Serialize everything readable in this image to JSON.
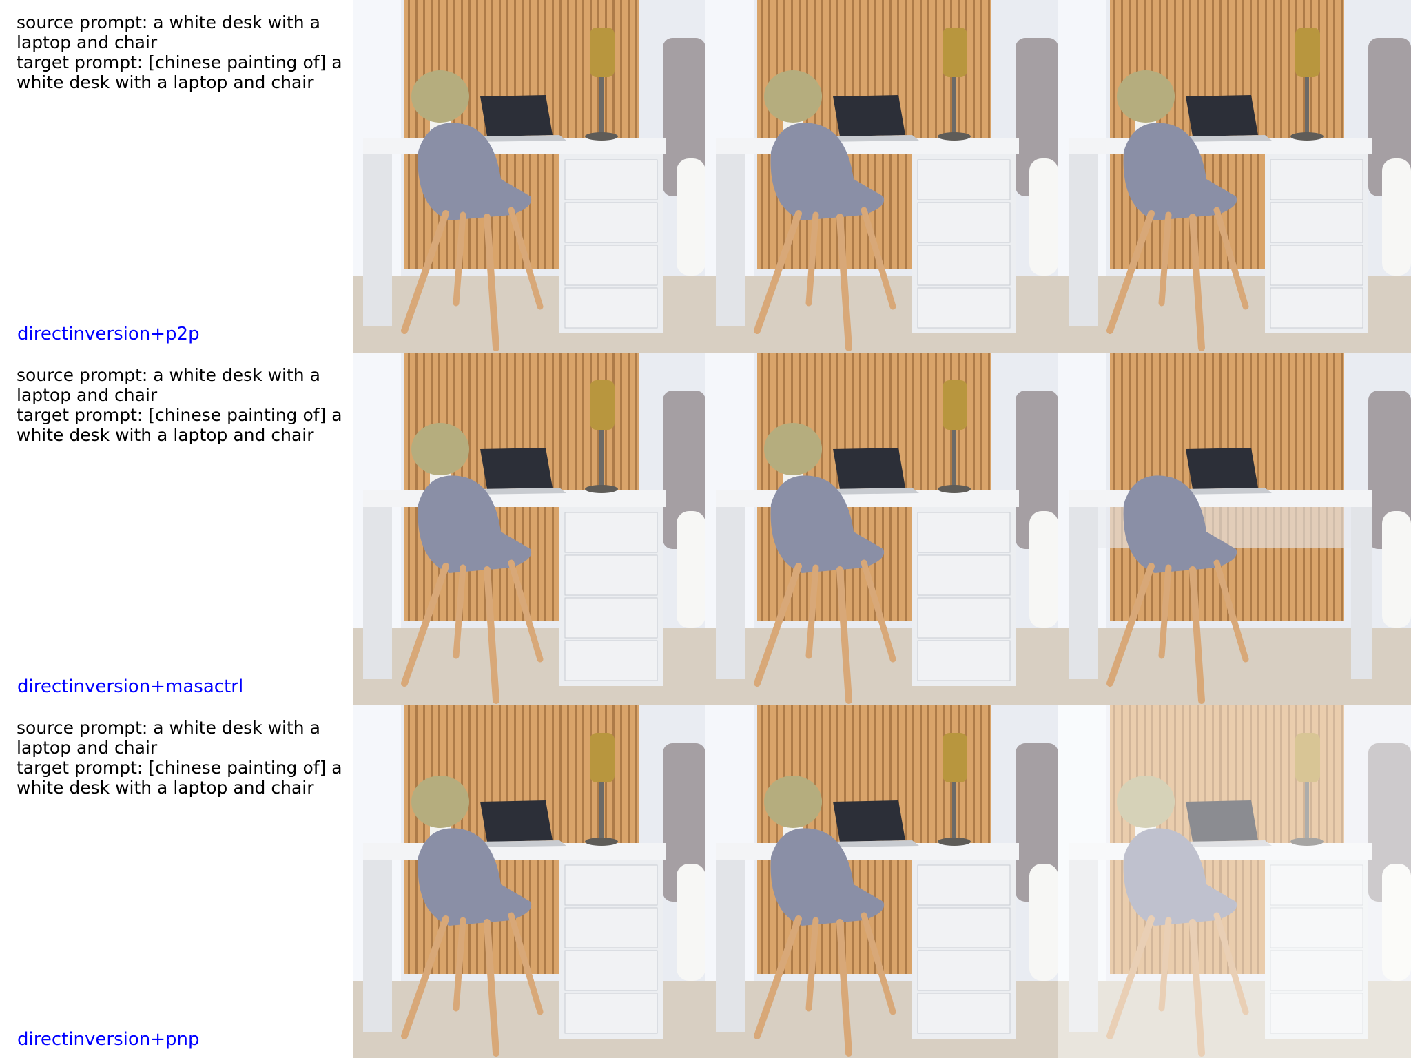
{
  "rows": [
    {
      "source_prompt": "source prompt: a white desk with a laptop and chair",
      "target_prompt": "target prompt: [chinese painting of] a white desk with a laptop and chair",
      "method": "directinversion+p2p",
      "images": [
        {
          "kind": "original",
          "lamp": true,
          "drawers": true,
          "plant": true,
          "painted": false
        },
        {
          "kind": "reconstruction",
          "lamp": true,
          "drawers": true,
          "plant": true,
          "painted": false
        },
        {
          "kind": "edited",
          "lamp": true,
          "drawers": true,
          "plant": true,
          "painted": false
        }
      ]
    },
    {
      "source_prompt": "source prompt: a white desk with a laptop and chair",
      "target_prompt": "target prompt: [chinese painting of] a white desk with a laptop and chair",
      "method": "directinversion+masactrl",
      "images": [
        {
          "kind": "original",
          "lamp": true,
          "drawers": true,
          "plant": true,
          "painted": false
        },
        {
          "kind": "reconstruction",
          "lamp": true,
          "drawers": true,
          "plant": true,
          "painted": false
        },
        {
          "kind": "edited",
          "lamp": false,
          "drawers": false,
          "plant": false,
          "painted": false
        }
      ]
    },
    {
      "source_prompt": "source prompt: a white desk with a laptop and chair",
      "target_prompt": "target prompt: [chinese painting of] a white desk with a laptop and chair",
      "method": "directinversion+pnp",
      "images": [
        {
          "kind": "original",
          "lamp": true,
          "drawers": true,
          "plant": true,
          "painted": false
        },
        {
          "kind": "reconstruction",
          "lamp": true,
          "drawers": true,
          "plant": true,
          "painted": false
        },
        {
          "kind": "edited",
          "lamp": true,
          "drawers": true,
          "plant": true,
          "painted": true
        }
      ]
    }
  ],
  "colors": {
    "wood": "#d9a46a",
    "wood_dark": "#9a6a3a",
    "desk": "#f3f4f6",
    "chair": "#8a8fa6",
    "chair_legs": "#d8a878",
    "lamp": "#b8963e",
    "wall": "#e9ecf2",
    "floor": "#d8cfc2",
    "method_text": "#0000ff"
  }
}
